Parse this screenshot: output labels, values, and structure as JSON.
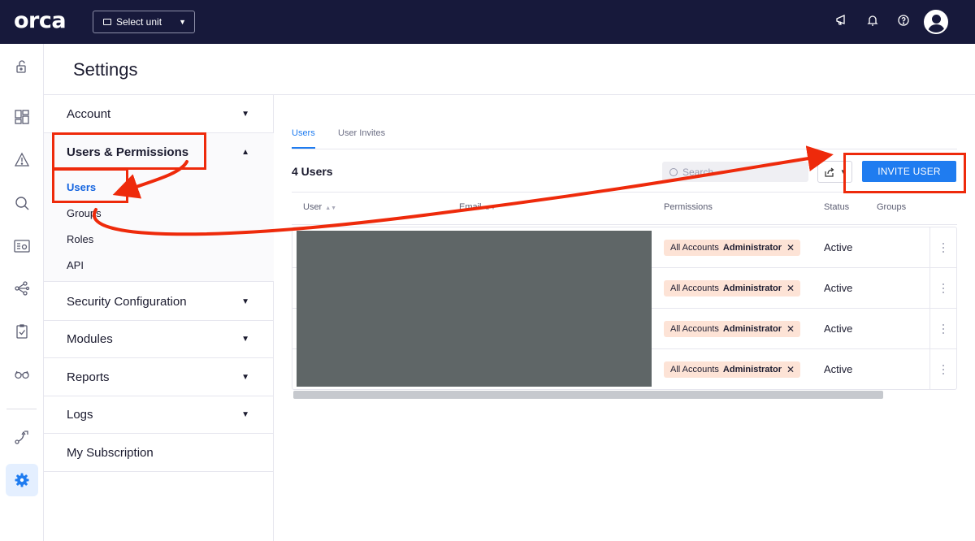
{
  "topbar": {
    "logo": "orca",
    "unit_select": "Select unit"
  },
  "page": {
    "title": "Settings"
  },
  "settings_nav": {
    "account": "Account",
    "users_permissions": "Users & Permissions",
    "sub_items": [
      "Users",
      "Groups",
      "Roles",
      "API"
    ],
    "security": "Security Configuration",
    "modules": "Modules",
    "reports": "Reports",
    "logs": "Logs",
    "subscription": "My Subscription"
  },
  "tabs": [
    "Users",
    "User Invites"
  ],
  "users": {
    "count_label": "4 Users",
    "search_placeholder": "Search",
    "invite_button": "INVITE USER",
    "columns": [
      "User",
      "Email",
      "Permissions",
      "Status",
      "Groups"
    ],
    "rows": [
      {
        "perm_scope": "All Accounts",
        "perm_role": "Administrator",
        "status": "Active"
      },
      {
        "perm_scope": "All Accounts",
        "perm_role": "Administrator",
        "status": "Active"
      },
      {
        "perm_scope": "All Accounts",
        "perm_role": "Administrator",
        "status": "Active"
      },
      {
        "perm_scope": "All Accounts",
        "perm_role": "Administrator",
        "status": "Active"
      }
    ]
  },
  "icons": {
    "rail": [
      "lock-icon",
      "dashboard-icon",
      "alert-icon",
      "search-icon",
      "inventory-icon",
      "graph-icon",
      "compliance-icon",
      "vulnerability-icon",
      "integrations-icon",
      "settings-icon"
    ],
    "topbar": [
      "megaphone-icon",
      "bell-icon",
      "help-icon",
      "avatar-icon"
    ]
  },
  "colors": {
    "topbar": "#17193b",
    "accent": "#1f7cf0",
    "annotation": "#ee2a0b",
    "permission_chip": "#fde3d6"
  }
}
